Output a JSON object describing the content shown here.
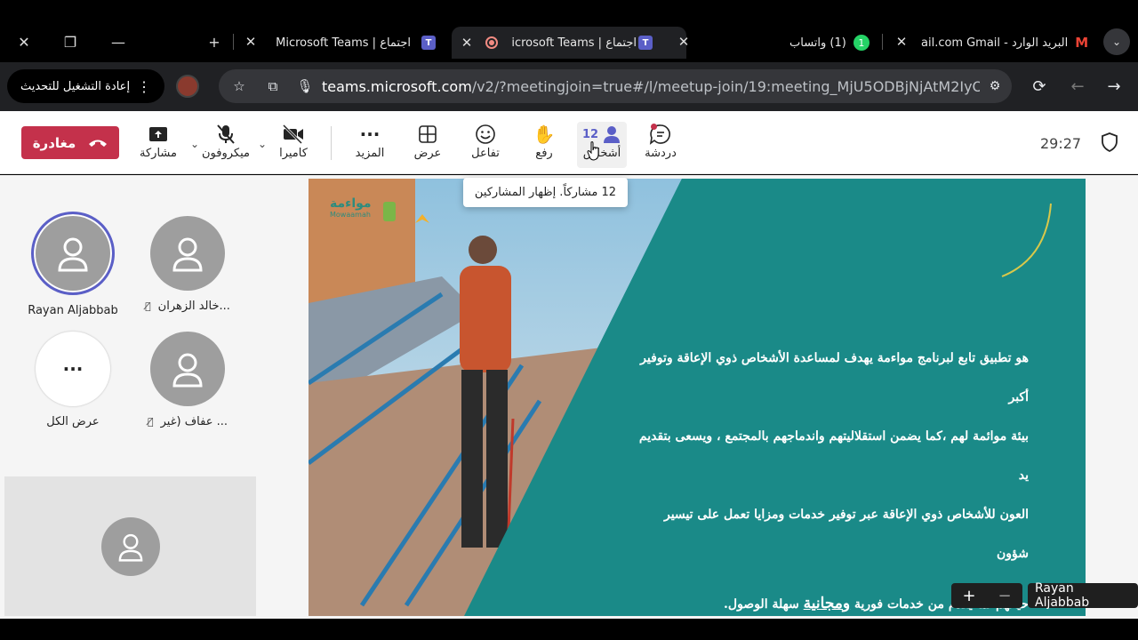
{
  "browser": {
    "tabs": [
      {
        "title": "البريد الوارد - Gmail",
        "title_suffix": "ail.com",
        "icon": "gmail-icon"
      },
      {
        "title": "(1) واتساب",
        "icon": "whatsapp-icon",
        "badge": "1"
      },
      {
        "title": "اجتماع | Microsoft Teams",
        "display": "اجتماع | icrosoft Teams",
        "icon": "teams-icon",
        "active": true,
        "recording": true
      },
      {
        "title": "اجتماع | Microsoft Teams",
        "icon": "teams-icon"
      }
    ],
    "new_tab": "+",
    "url_host": "teams.microsoft.com",
    "url_path": "/v2/?meetingjoin=true#/l/meetup-join/19:meeting_MjU5ODBjNjAtM2IyOS00M...",
    "update_button": "إعادة التشغيل للتحديث"
  },
  "teams": {
    "leave_label": "مغادرة",
    "controls": {
      "share": "مشاركة",
      "mic": "ميكروفون",
      "camera": "كاميرا",
      "more": "المزيد",
      "view": "عرض",
      "react": "تفاعل",
      "raise": "رفع",
      "people": "أشخاص",
      "people_count": "12",
      "chat": "دردشة"
    },
    "timer": "29:27",
    "tooltip": "12 مشاركاً. إظهار المشاركين"
  },
  "participants": [
    {
      "name": "Rayan Aljabbab",
      "speaking": true,
      "muted": false
    },
    {
      "name": "خالد الزهران...",
      "speaking": false,
      "muted": true
    },
    {
      "name": "عرض الكل",
      "more": true
    },
    {
      "name": "عفاف (غير ...",
      "speaking": false,
      "muted": true
    }
  ],
  "slide": {
    "logo_ar": "مواءمة",
    "logo_en": "Mowaamah",
    "text_lines": [
      "هو تطبيق تابع لبرنامج مواءمة يهدف لمساعدة الأشخاص ذوي الإعاقة وتوفير أكبر",
      "بيئة موائمة لهم ،كما يضمن استقلاليتهم واندماجهم بالمجتمع ، ويسعى بتقديم يد",
      "العون للأشخاص ذوي الإعاقة عبر توفير خدمات ومزايا تعمل على تيسير شؤون"
    ],
    "last_line_start": "حياتهم لما يقدم من خدمات فورية",
    "last_line_highlight": "ومجانية",
    "last_line_end": "سهلة الوصول."
  },
  "presenter_tag": "Rayan Aljabbab",
  "zoom": {
    "plus": "+",
    "minus": "−"
  },
  "colors": {
    "leave": "#c4314b",
    "accent": "#5b5fc7",
    "slide_bg": "#1a8a88"
  }
}
